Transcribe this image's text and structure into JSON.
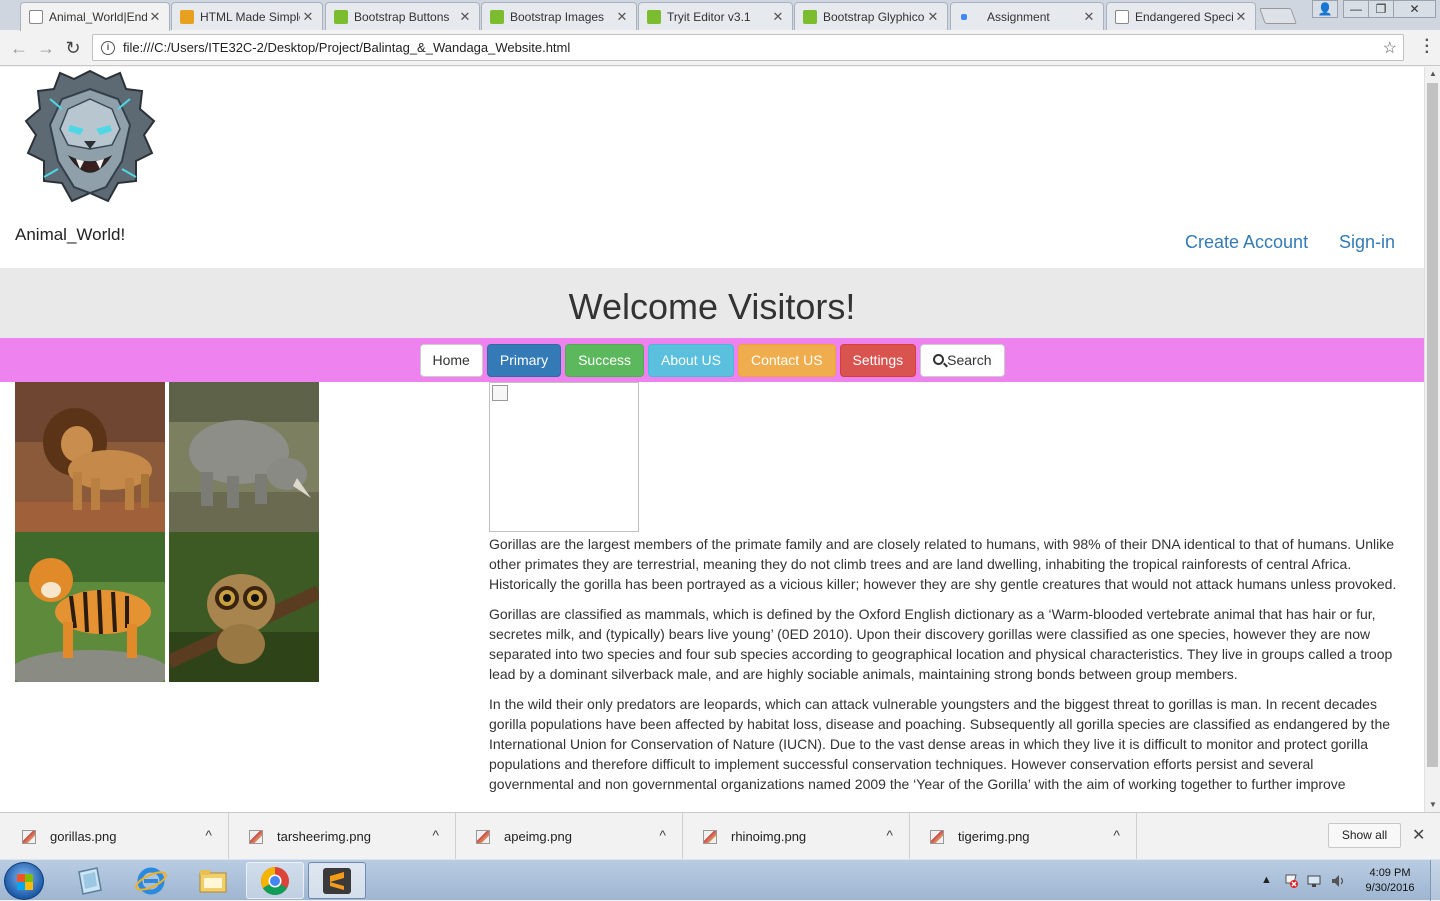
{
  "browser": {
    "tabs": [
      {
        "title": "Animal_World|Endangered Species",
        "favicon": "document-icon",
        "active": true
      },
      {
        "title": "HTML Made Simple",
        "favicon": "html-icon"
      },
      {
        "title": "Bootstrap Buttons",
        "favicon": "w3schools-icon"
      },
      {
        "title": "Bootstrap Images",
        "favicon": "w3schools-icon"
      },
      {
        "title": "Tryit Editor v3.1",
        "favicon": "w3schools-icon"
      },
      {
        "title": "Bootstrap Glyphicons",
        "favicon": "w3schools-icon"
      },
      {
        "title": "Assignment",
        "favicon": "loading-icon"
      },
      {
        "title": "Endangered Species",
        "favicon": "document-icon"
      }
    ],
    "tab_close": "✕",
    "url": "file:///C:/Users/ITE32C-2/Desktop/Project/Balintag_&_Wandaga_Website.html",
    "back": "←",
    "forward": "→",
    "reload": "↻",
    "bookmark": "☆",
    "window_controls": {
      "user": "👤",
      "minimize": "—",
      "restore": "❐",
      "close": "✕"
    }
  },
  "page": {
    "site_name": "Animal_World!",
    "create_account": "Create Account",
    "sign_in": "Sign-in",
    "welcome": "Welcome Visitors!",
    "nav": {
      "home": "Home",
      "primary": "Primary",
      "success": "Success",
      "about": "About US",
      "contact": "Contact US",
      "settings": "Settings",
      "search": "Search"
    },
    "gallery": [
      "lion",
      "rhino",
      "tiger",
      "tarsier"
    ],
    "paragraphs": [
      "Gorillas are the largest members of the primate family and are closely related to humans, with 98% of their DNA identical to that of humans. Unlike other primates they are terrestrial, meaning they do not climb trees and are land dwelling, inhabiting the tropical rainforests of central Africa. Historically the gorilla has been portrayed as a vicious killer; however they are shy gentle creatures that would not attack humans unless provoked.",
      "Gorillas are classified as mammals, which is defined by the Oxford English dictionary as a ‘Warm-blooded vertebrate animal that has hair or fur, secretes milk, and (typically) bears live young’ (0ED 2010). Upon their discovery gorillas were classified as one species, however they are now separated into two species and four sub species according to geographical location and physical characteristics. They live in groups called a troop lead by a dominant silverback male, and are highly sociable animals, maintaining strong bonds between group members.",
      "In the wild their only predators are leopards, which can attack vulnerable youngsters and the biggest threat to gorillas is man. In recent decades gorilla populations have been affected by habitat loss, disease and poaching. Subsequently all gorilla species are classified as endangered by the International Union for Conservation of Nature (IUCN). Due to the vast dense areas in which they live it is difficult to monitor and protect gorilla populations and therefore difficult to implement successful conservation techniques. However conservation efforts persist and several governmental and non governmental organizations named 2009 the ‘Year of the Gorilla’ with the aim of working together to further improve"
    ],
    "colors": {
      "link": "#337ab7",
      "navbar": "#ee82ee",
      "jumbotron": "#e9e9e9"
    }
  },
  "downloads": {
    "items": [
      "gorillas.png",
      "tarsheerimg.png",
      "apeimg.png",
      "rhinoimg.png",
      "tigerimg.png"
    ],
    "chevron": "^",
    "show_all": "Show all",
    "close": "✕"
  },
  "taskbar": {
    "apps": [
      "start-button",
      "file-icon",
      "internet-explorer-icon",
      "file-explorer-icon",
      "chrome-icon",
      "sublime-text-icon"
    ],
    "tray_arrow": "▲",
    "time": "4:09 PM",
    "date": "9/30/2016"
  }
}
